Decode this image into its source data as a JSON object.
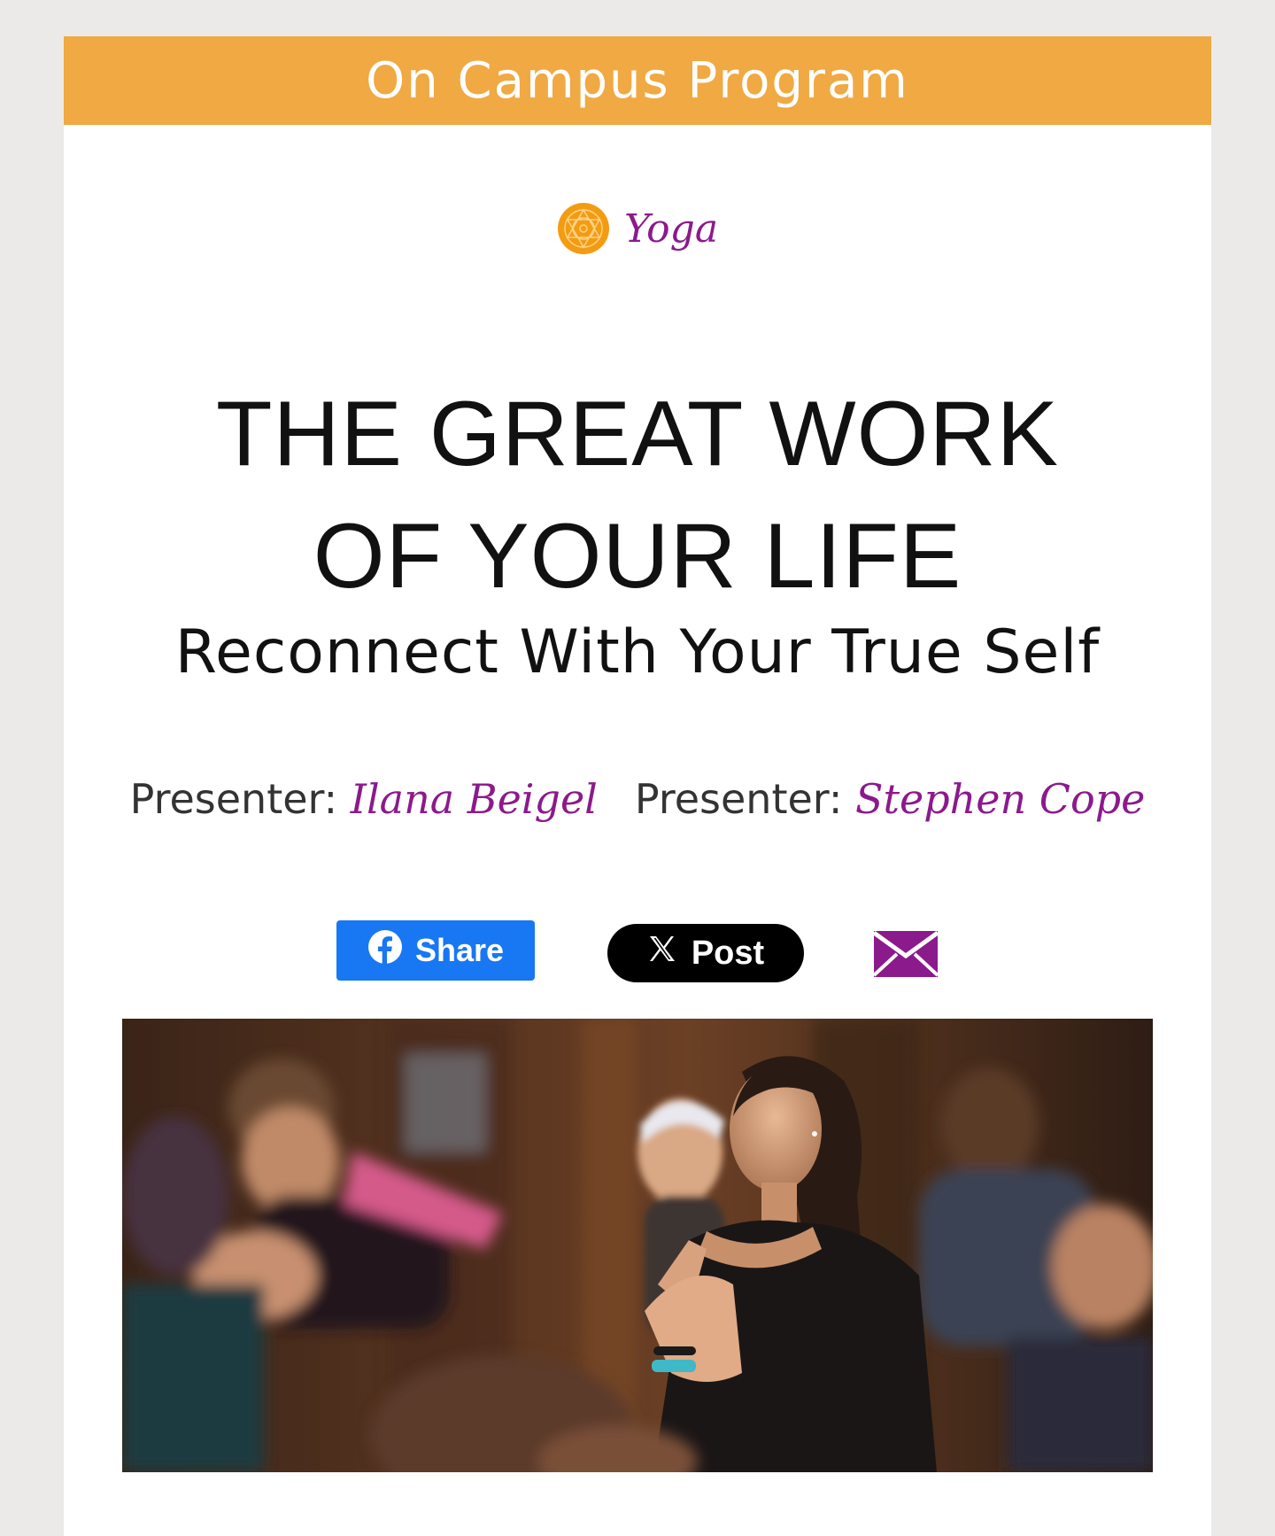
{
  "colors": {
    "banner": "#f0a943",
    "accent_purple": "#8b1a8c",
    "facebook_blue": "#1877f2",
    "x_black": "#000000"
  },
  "banner": {
    "title": "On Campus Program"
  },
  "category": {
    "icon": "mandala-icon",
    "label": "Yoga"
  },
  "headline": {
    "line1": "THE GREAT WORK",
    "line2": "OF YOUR LIFE"
  },
  "subtitle": "Reconnect With Your True Self",
  "presenters": [
    {
      "prefix": "Presenter: ",
      "name": "Ilana Beigel"
    },
    {
      "prefix": "Presenter: ",
      "name": "Stephen Cope"
    }
  ],
  "share": {
    "facebook_label": "Share",
    "facebook_icon": "facebook-icon",
    "x_label": "Post",
    "x_icon": "x-logo-icon",
    "email_icon": "envelope-icon"
  },
  "hero_image": {
    "description_icon": "yoga-class-photo"
  }
}
